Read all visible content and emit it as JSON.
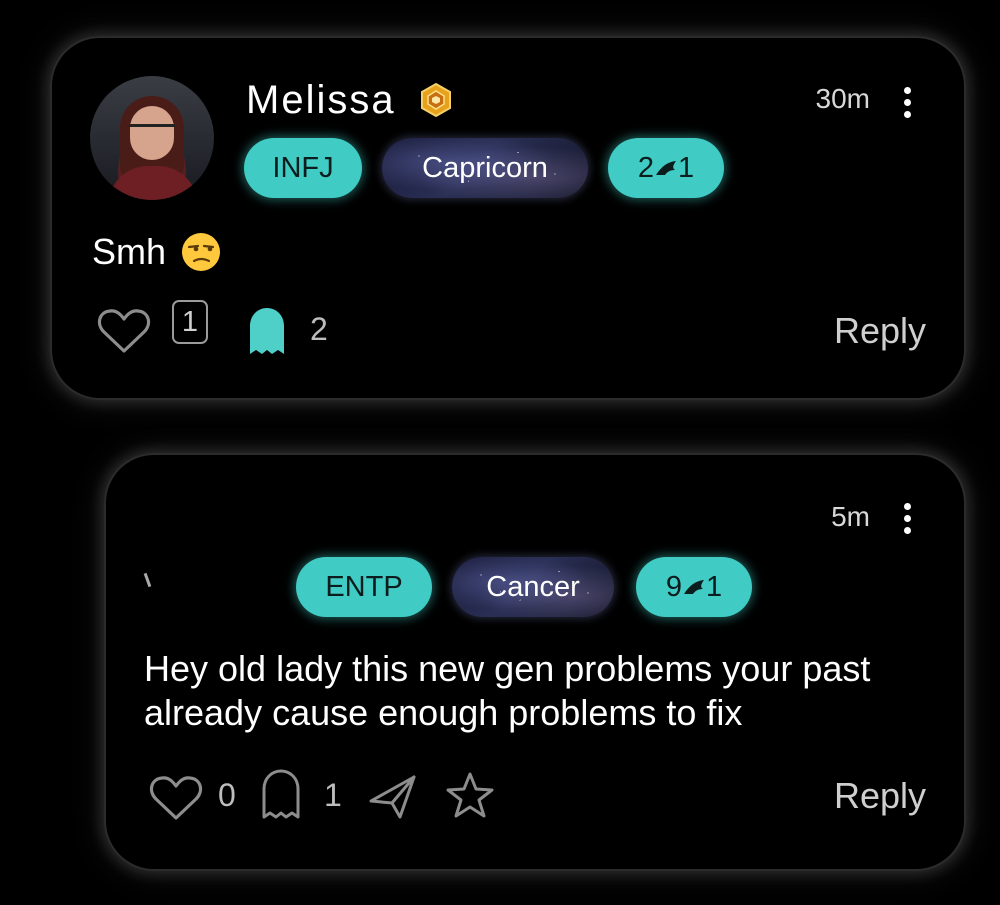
{
  "comments": [
    {
      "username": "Melissa",
      "time": "30m",
      "tags": {
        "mbti": "INFJ",
        "zodiac": "Capricorn",
        "enneagram_left": "2",
        "enneagram_right": "1"
      },
      "text": "Smh",
      "emoji": "unamused-face-emoji",
      "likes": "1",
      "ghost_count": "2",
      "reply_label": "Reply"
    },
    {
      "time": "5m",
      "tags": {
        "mbti": "ENTP",
        "zodiac": "Cancer",
        "enneagram_left": "9",
        "enneagram_right": "1"
      },
      "text": "Hey old lady this new gen problems your past already cause enough problems to fix",
      "likes": "0",
      "ghost_count": "1",
      "reply_label": "Reply"
    }
  ],
  "icons": [
    "heart-icon",
    "ghost-icon",
    "share-icon",
    "star-icon",
    "more-icon",
    "badge-icon",
    "wing-icon"
  ],
  "colors": {
    "accent": "#40cbc4",
    "background": "#000000"
  }
}
